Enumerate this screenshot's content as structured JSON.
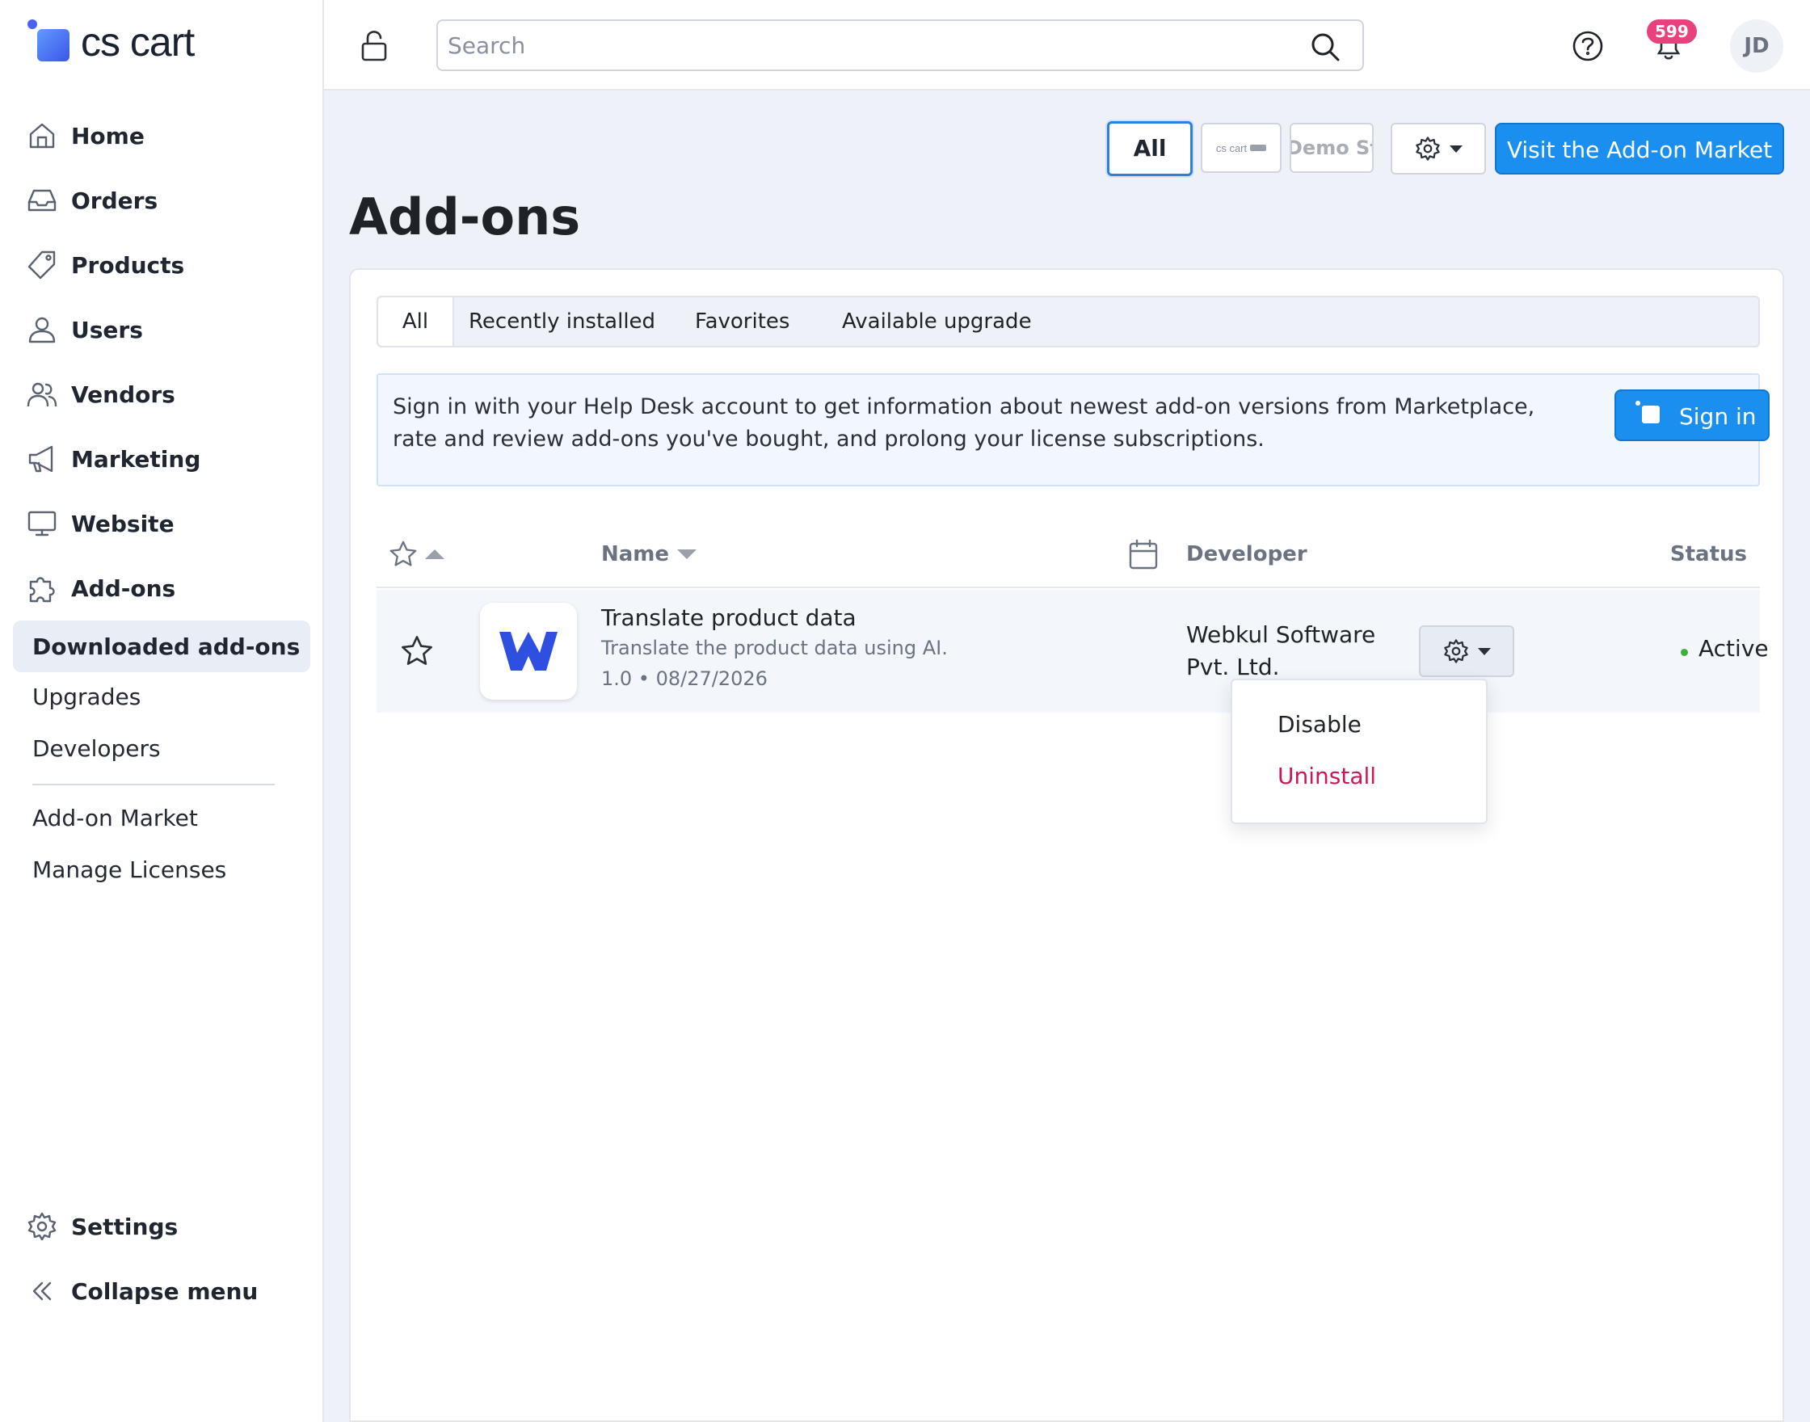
{
  "brand": {
    "logo_text": "cs cart"
  },
  "sidebar": {
    "items": [
      {
        "label": "Home",
        "icon": "home-icon"
      },
      {
        "label": "Orders",
        "icon": "inbox-icon"
      },
      {
        "label": "Products",
        "icon": "tag-icon"
      },
      {
        "label": "Users",
        "icon": "user-icon"
      },
      {
        "label": "Vendors",
        "icon": "users-icon"
      },
      {
        "label": "Marketing",
        "icon": "megaphone-icon"
      },
      {
        "label": "Website",
        "icon": "monitor-icon"
      },
      {
        "label": "Add-ons",
        "icon": "puzzle-icon"
      }
    ],
    "subitems": {
      "active": "Downloaded add-ons",
      "upgrades": "Upgrades",
      "developers": "Developers",
      "market": "Add-on Market",
      "licenses": "Manage Licenses"
    },
    "settings": "Settings",
    "collapse": "Collapse menu"
  },
  "header": {
    "search_placeholder": "Search",
    "notifications_count": "599",
    "avatar_initials": "JD"
  },
  "toolbar": {
    "store_all": "All",
    "store_logo_text": "cs cart",
    "store_demo": "Demo Store",
    "market_button": "Visit the Add-on Market"
  },
  "page": {
    "title": "Add-ons"
  },
  "tabs": [
    "All",
    "Recently installed",
    "Favorites",
    "Available upgrade"
  ],
  "notice": {
    "text": "Sign in with your Help Desk account to get information about newest add-on versions from Marketplace, rate and review add-ons you've bought, and prolong your license subscriptions.",
    "sign_in": "Sign in"
  },
  "table": {
    "columns": {
      "name": "Name",
      "developer": "Developer",
      "status": "Status"
    },
    "rows": [
      {
        "name": "Translate product data",
        "description": "Translate the product data using AI.",
        "meta": "1.0 • 08/27/2026",
        "developer": "Webkul Software Pvt. Ltd.",
        "status": "Active",
        "status_color": "#3fae3a"
      }
    ]
  },
  "dropdown": {
    "disable": "Disable",
    "uninstall": "Uninstall",
    "uninstall_color": "#c8185a"
  },
  "colors": {
    "accent": "#1b8ff0",
    "badge": "#e9417d",
    "logo_blue": "#2f4fe0"
  }
}
